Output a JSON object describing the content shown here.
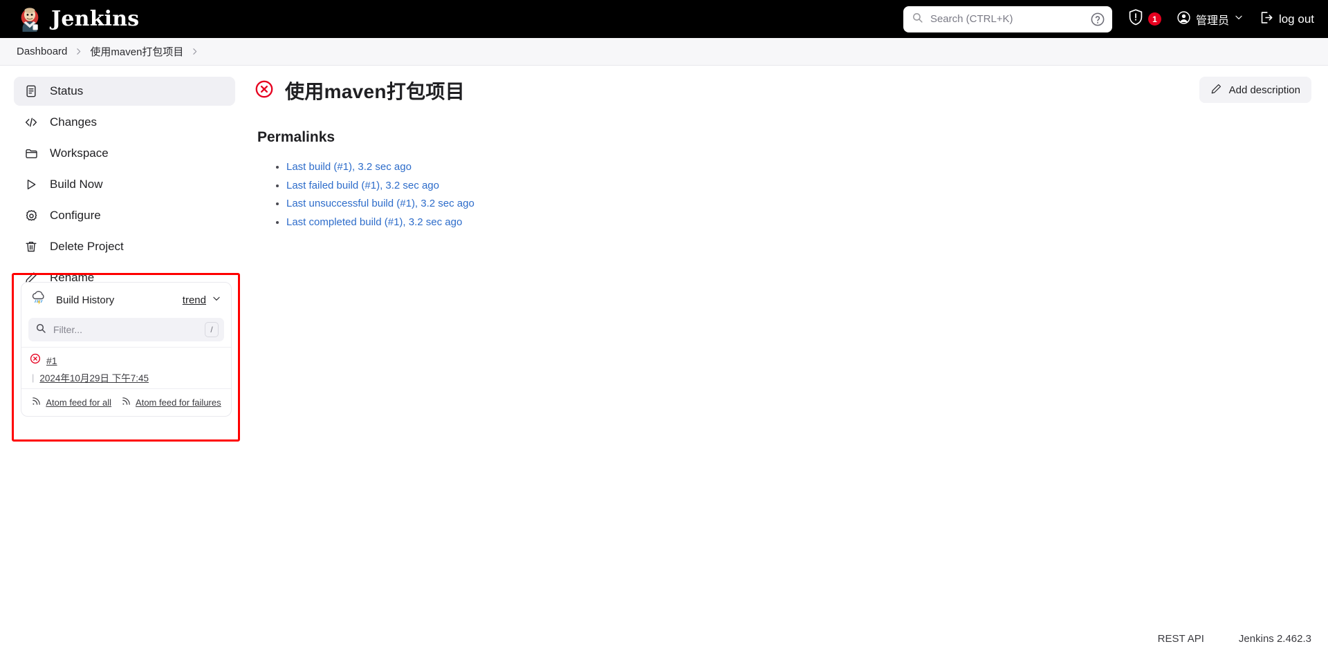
{
  "header": {
    "brand": "Jenkins",
    "brand_logo_icon": "jenkins-butler-logo",
    "search": {
      "placeholder": "Search (CTRL+K)",
      "value": "",
      "icon": "search-icon"
    },
    "help_icon": "question-circle-icon",
    "security": {
      "icon": "shield-alert-icon",
      "badge_count": "1",
      "badge_color": "#e6001f"
    },
    "user": {
      "icon": "user-circle-icon",
      "name": "管理员",
      "chevron_icon": "chevron-down-icon"
    },
    "logout": {
      "icon": "logout-icon",
      "label": "log out"
    }
  },
  "breadcrumb": {
    "items": [
      {
        "label": "Dashboard"
      },
      {
        "label": "使用maven打包项目"
      }
    ],
    "separator": "›"
  },
  "sidebar": {
    "items": [
      {
        "label": "Status",
        "icon": "document-icon",
        "active": true
      },
      {
        "label": "Changes",
        "icon": "code-brackets-icon",
        "active": false
      },
      {
        "label": "Workspace",
        "icon": "folder-icon",
        "active": false
      },
      {
        "label": "Build Now",
        "icon": "play-triangle-icon",
        "active": false
      },
      {
        "label": "Configure",
        "icon": "gear-icon",
        "active": false
      },
      {
        "label": "Delete Project",
        "icon": "trash-icon",
        "active": false
      },
      {
        "label": "Rename",
        "icon": "pencil-icon",
        "active": false
      }
    ],
    "build_history": {
      "title": "Build History",
      "weather_icon": "storm-cloud-icon",
      "trend_label": "trend",
      "trend_chevron_icon": "chevron-down-icon",
      "filter": {
        "placeholder": "Filter...",
        "value": "",
        "icon": "search-icon",
        "shortcut_key": "/"
      },
      "builds": [
        {
          "number": "#1",
          "status_icon": "failed-circle-x-icon",
          "status_color": "#e6001f",
          "date": "2024年10月29日 下午7:45"
        }
      ],
      "feeds": [
        {
          "label": "Atom feed for all",
          "icon": "rss-icon"
        },
        {
          "label": "Atom feed for failures",
          "icon": "rss-icon"
        }
      ],
      "highlight_color": "#ff0000"
    }
  },
  "main": {
    "status_icon": "failed-circle-x-icon",
    "status_color": "#e6001f",
    "title": "使用maven打包项目",
    "add_description": {
      "label": "Add description",
      "icon": "pencil-icon"
    },
    "permalinks_heading": "Permalinks",
    "permalinks": [
      {
        "label": "Last build (#1), 3.2 sec ago"
      },
      {
        "label": "Last failed build (#1), 3.2 sec ago"
      },
      {
        "label": "Last unsuccessful build (#1), 3.2 sec ago"
      },
      {
        "label": "Last completed build (#1), 3.2 sec ago"
      }
    ],
    "link_color": "#2d6cca"
  },
  "footer": {
    "rest_api": "REST API",
    "version": "Jenkins 2.462.3"
  }
}
